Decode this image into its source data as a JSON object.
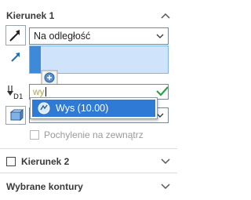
{
  "section1": {
    "title": "Kierunek 1"
  },
  "end_condition": {
    "value": "Na odległość"
  },
  "depth_input": {
    "value": "wy"
  },
  "autocomplete": {
    "item": "Wys (10.00)"
  },
  "draft_outward": {
    "label": "Pochylenie na zewnątrz",
    "checked": false,
    "enabled": false
  },
  "section2": {
    "title": "Kierunek 2",
    "checked": false
  },
  "section3": {
    "title": "Wybrane kontury"
  },
  "colors": {
    "accent": "#2f7ad4",
    "selection_bg": "#cfe4fb",
    "confirm": "#2ea043"
  }
}
